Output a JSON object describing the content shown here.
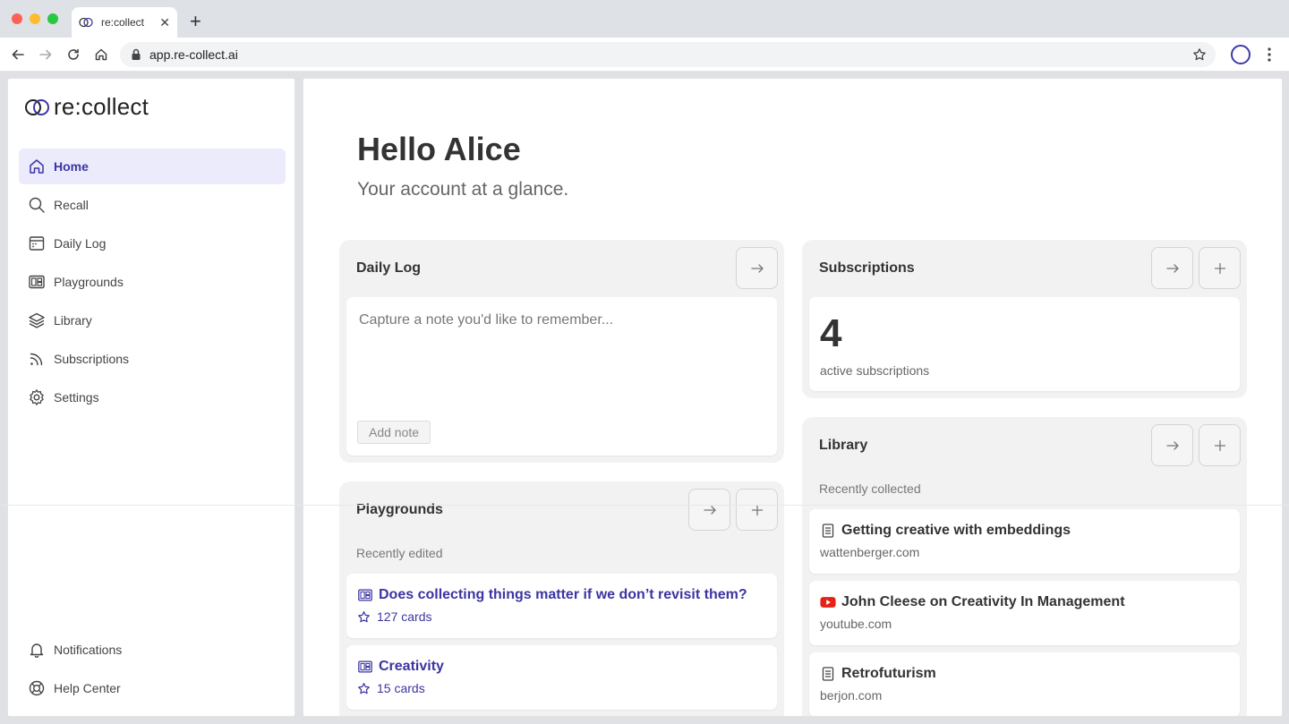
{
  "browser": {
    "tab_title": "re:collect",
    "tab_close": "✕",
    "new_tab": "+",
    "url": "app.re-collect.ai"
  },
  "app": {
    "logo_text": "re:collect",
    "accent": "#3b35a1",
    "nav": [
      {
        "label": "Home",
        "icon": "home-icon",
        "active": true
      },
      {
        "label": "Recall",
        "icon": "search-icon"
      },
      {
        "label": "Daily Log",
        "icon": "calendar-icon"
      },
      {
        "label": "Playgrounds",
        "icon": "playground-icon"
      },
      {
        "label": "Library",
        "icon": "layers-icon"
      },
      {
        "label": "Subscriptions",
        "icon": "rss-icon"
      },
      {
        "label": "Settings",
        "icon": "gear-icon"
      }
    ],
    "bottom_nav": [
      {
        "label": "Notifications",
        "icon": "bell-icon"
      },
      {
        "label": "Help Center",
        "icon": "lifebuoy-icon"
      }
    ]
  },
  "main": {
    "greeting": "Hello Alice",
    "subtitle": "Your account at a glance."
  },
  "daily_log": {
    "title": "Daily Log",
    "placeholder": "Capture a note you'd like to remember...",
    "add_note": "Add note"
  },
  "subscriptions": {
    "title": "Subscriptions",
    "count": "4",
    "caption": "active subscriptions"
  },
  "library": {
    "title": "Library",
    "subheading": "Recently collected",
    "items": [
      {
        "title": "Getting creative with embeddings",
        "source": "wattenberger.com",
        "icon": "document-icon"
      },
      {
        "title": "John Cleese on Creativity In Management",
        "source": "youtube.com",
        "icon": "youtube-icon"
      },
      {
        "title": "Retrofuturism",
        "source": "berjon.com",
        "icon": "document-icon"
      }
    ]
  },
  "playgrounds": {
    "title": "Playgrounds",
    "subheading": "Recently edited",
    "items": [
      {
        "title": "Does collecting things matter if we don’t revisit them?",
        "cards": "127 cards"
      },
      {
        "title": "Creativity",
        "cards": "15 cards"
      }
    ]
  },
  "buttons": {
    "arrow": "→",
    "plus": "+"
  }
}
